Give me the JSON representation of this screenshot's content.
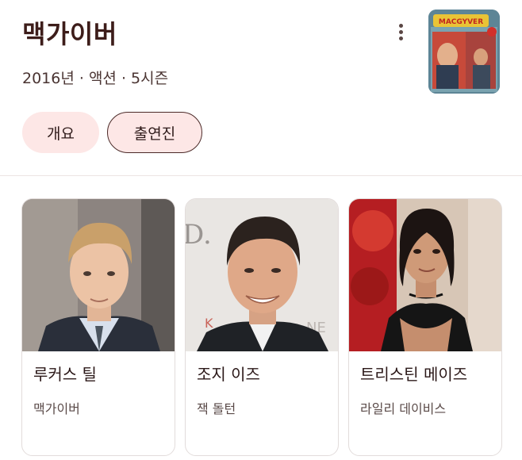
{
  "show": {
    "title": "맥가이버",
    "subtitle": "2016년 · 액션 · 5시즌",
    "poster_text": "MACGYVER"
  },
  "tabs": [
    {
      "label": "개요",
      "selected": false
    },
    {
      "label": "출연진",
      "selected": true
    }
  ],
  "cast": [
    {
      "name": "루커스 틸",
      "role": "맥가이버"
    },
    {
      "name": "조지 이즈",
      "role": "잭 돌턴"
    },
    {
      "name": "트리스틴 메이즈",
      "role": "라일리 데이비스"
    }
  ],
  "colors": {
    "chip_bg": "#fde7e6",
    "title_text": "#3d1d1a",
    "border": "#e2dcdb"
  },
  "icons": [
    "more-vert-icon"
  ]
}
